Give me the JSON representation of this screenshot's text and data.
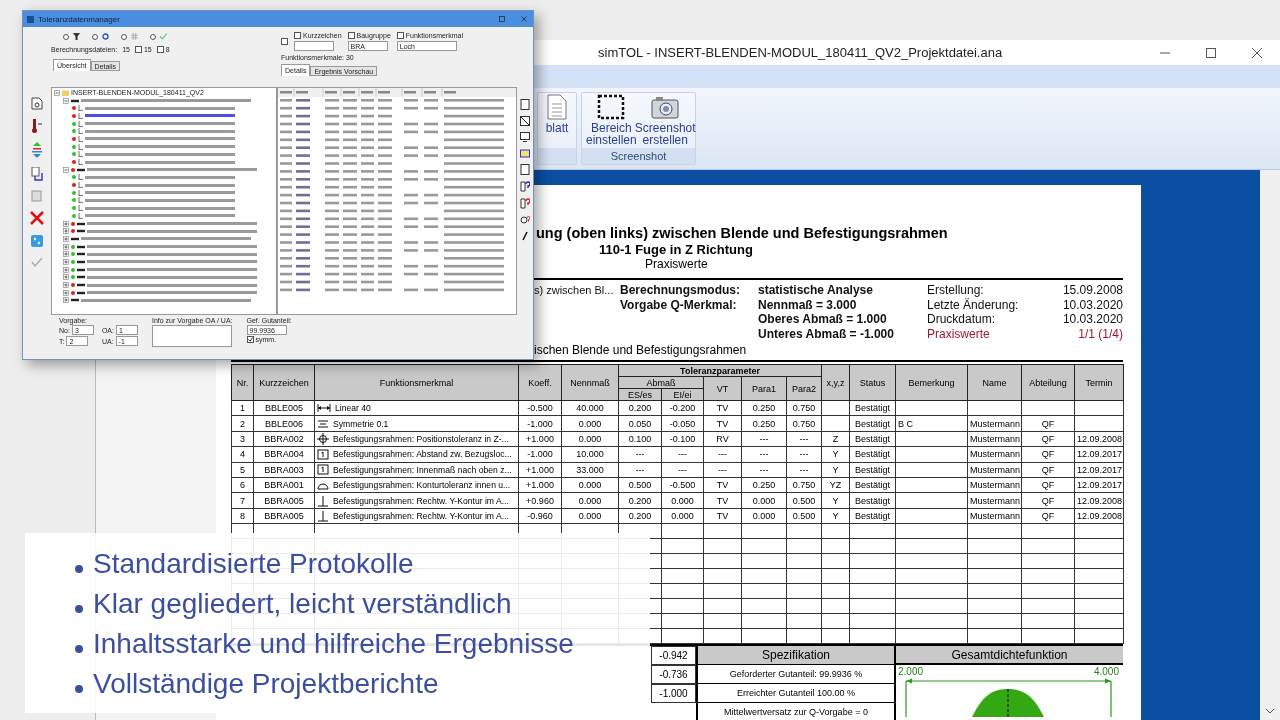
{
  "main_window": {
    "title": "simTOL - INSERT-BLENDEN-MODUL_180411_QV2_Projektdatei.ana",
    "ribbon_groups": [
      {
        "buttons": [
          {
            "label": "blatt",
            "kind": "document"
          }
        ]
      },
      {
        "label": "Screenshot",
        "buttons": [
          {
            "label": "Bereich einstellen",
            "kind": "region"
          },
          {
            "label": "Screenshot erstellen",
            "kind": "camera"
          }
        ]
      }
    ]
  },
  "report": {
    "title": "ung (oben links) zwischen Blende und Befestigungsrahmen",
    "subtitle": "110-1 Fuge in Z Richtung",
    "variant": "Praxiswerte",
    "info_partial": "s) zwischen Bl...",
    "info_rows": [
      {
        "label": "Berechnungsmodus:",
        "value": "statistische Analyse",
        "meta_label": "Erstellung:",
        "meta_value": "15.09.2008",
        "highlight": false
      },
      {
        "label": "Vorgabe Q-Merkmal:",
        "value": "Nennmaß = 3.000",
        "meta_label": "Letzte Änderung:",
        "meta_value": "10.03.2020",
        "highlight": false
      },
      {
        "value": "Oberes Abmaß = 1.000",
        "meta_label": "Druckdatum:",
        "meta_value": "10.03.2020",
        "highlight": false
      },
      {
        "value": "Unteres Abmaß = -1.000",
        "meta_label": "Praxiswerte",
        "meta_value": "1/1 (1/4)",
        "highlight": true
      }
    ],
    "description": "ischen Blende und Befestigungsrahmen",
    "columns": [
      "Nr.",
      "Kurzzeichen",
      "Funktionsmerkmal",
      "Koeff.",
      "Nennmaß",
      "x,y,z",
      "Status",
      "Bemerkung",
      "Name",
      "Abteilung",
      "Termin"
    ],
    "group_header": "Toleranzparameter",
    "abmass_header": "Abmaß",
    "sub_columns": [
      "ES/es",
      "EI/ei",
      "VT",
      "Para1",
      "Para2"
    ],
    "rows": [
      {
        "nr": "1",
        "code": "BBLE005",
        "kind": "linear",
        "feature": "Linear 40",
        "koeff": "-0.500",
        "nenn": "40.000",
        "es": "0.200",
        "ei": "-0.200",
        "vt": "TV",
        "p1": "0.250",
        "p2": "0.750",
        "status": "Bestätigt"
      },
      {
        "nr": "2",
        "code": "BBLE006",
        "kind": "symmetry",
        "feature": "Symmetrie 0.1",
        "koeff": "-1.000",
        "nenn": "0.000",
        "es": "0.050",
        "ei": "-0.050",
        "vt": "TV",
        "p1": "0.250",
        "p2": "0.750",
        "status": "Bestätigt",
        "note": "B C",
        "name": "Mustermann",
        "dept": "QF"
      },
      {
        "nr": "3",
        "code": "BBRA002",
        "kind": "position",
        "feature": "Befestigungsrahmen: Positionstoleranz in Z-...",
        "koeff": "+1.000",
        "nenn": "0.000",
        "es": "0.100",
        "ei": "-0.100",
        "vt": "RV",
        "p1": "---",
        "p2": "---",
        "xyz": "Z",
        "status": "Bestätigt",
        "name": "Mustermann",
        "dept": "QF",
        "date": "12.09.2008"
      },
      {
        "nr": "4",
        "code": "BBRA004",
        "kind": "boxed",
        "feature": "Befestigungsrahmen: Abstand zw. Bezugsloc...",
        "koeff": "-1.000",
        "nenn": "10.000",
        "es": "---",
        "ei": "---",
        "vt": "---",
        "p1": "---",
        "p2": "---",
        "xyz": "Y",
        "status": "Bestätigt",
        "name": "Mustermann",
        "dept": "QF",
        "date": "12.09.2017"
      },
      {
        "nr": "5",
        "code": "BBRA003",
        "kind": "boxed",
        "feature": "Befestigungsrahmen: Innenmaß nach oben z...",
        "koeff": "+1.000",
        "nenn": "33.000",
        "es": "---",
        "ei": "---",
        "vt": "---",
        "p1": "---",
        "p2": "---",
        "xyz": "Y",
        "status": "Bestätigt",
        "name": "Mustermann",
        "dept": "QF",
        "date": "12.09.2017"
      },
      {
        "nr": "6",
        "code": "BBRA001",
        "kind": "profile",
        "feature": "Befestigungsrahmen: Konturtoleranz innen u...",
        "koeff": "+1.000",
        "nenn": "0.000",
        "es": "0.500",
        "ei": "-0.500",
        "vt": "TV",
        "p1": "0.250",
        "p2": "0.750",
        "xyz": "YZ",
        "status": "Bestätigt",
        "name": "Mustermann",
        "dept": "QF",
        "date": "12.09.2017"
      },
      {
        "nr": "7",
        "code": "BBRA005",
        "kind": "perpendicular",
        "feature": "Befestigungsrahmen: Rechtw. Y-Kontur im A...",
        "koeff": "+0.960",
        "nenn": "0.000",
        "es": "0.200",
        "ei": "0.000",
        "vt": "TV",
        "p1": "0.000",
        "p2": "0.500",
        "xyz": "Y",
        "status": "Bestätigt",
        "name": "Mustermann",
        "dept": "QF",
        "date": "12.09.2008"
      },
      {
        "nr": "8",
        "code": "BBRA005",
        "kind": "perpendicular",
        "feature": "Befestigungsrahmen: Rechtw. Y-Kontur im A...",
        "koeff": "-0.960",
        "nenn": "0.000",
        "es": "0.200",
        "ei": "0.000",
        "vt": "TV",
        "p1": "0.000",
        "p2": "0.500",
        "xyz": "Y",
        "status": "Bestätigt",
        "name": "Mustermann",
        "dept": "QF",
        "date": "12.09.2008"
      }
    ],
    "summary_values": [
      "-0.942",
      "-0.736",
      "-1.000"
    ],
    "spec_title": "Spezifikation",
    "spec_rows": [
      "Geforderter Gutanteil: 99.9936 %",
      "Erreichter Gutanteil 100.00 %",
      "Mittelwertversatz zur Q-Vorgabe = 0"
    ],
    "density_title": "Gesamtdichtefunktion",
    "density_min": "2.000",
    "density_max": "4.000"
  },
  "tool_window": {
    "title": "Toleranzdatenmanager",
    "radios": [
      {
        "kind": "filter",
        "selected": false
      },
      {
        "kind": "refresh",
        "selected": false
      },
      {
        "kind": "grid",
        "selected": false
      },
      {
        "kind": "check",
        "selected": false
      }
    ],
    "calc_label": "Berechnungsdateien:",
    "calc_value": "15",
    "calc_options": [
      {
        "value": "15",
        "checked": false
      },
      {
        "value": "8",
        "checked": false
      }
    ],
    "all_checkbox": {
      "checked": false
    },
    "filters": [
      {
        "label": "Kurzzeichen",
        "checked": false
      },
      {
        "label": "Baugruppe",
        "checked": false,
        "value": "BRA"
      },
      {
        "label": "Funktionsmerkmal",
        "checked": false,
        "value": "Loch"
      }
    ],
    "count": "Funktionsmerkmale: 30",
    "left_tabs": [
      {
        "label": "Übersicht",
        "selected": true
      },
      {
        "label": "Details",
        "selected": false
      }
    ],
    "right_tabs": [
      {
        "label": "Details",
        "selected": true
      },
      {
        "label": "Ergebnis Vorschau",
        "selected": false
      }
    ],
    "tree": {
      "label": "INSERT-BLENDEN-MODUL_180411_QV2",
      "expanded": true,
      "children": [
        {
          "expanded": true,
          "children": [
            {
              "color": "#e02020",
              "selected": false
            },
            {
              "color": "#e02020",
              "selected": true
            },
            {
              "color": "#2fc22f",
              "selected": false
            },
            {
              "color": "#2fc22f",
              "selected": false
            },
            {
              "color": "#e02020",
              "selected": false
            },
            {
              "color": "#2fc22f",
              "selected": false
            },
            {
              "color": "#2fc22f",
              "selected": false
            },
            {
              "color": "#e02020",
              "selected": false
            }
          ]
        },
        {
          "color": "#e02020",
          "expanded": true,
          "children": [
            {
              "color": "#2fc22f",
              "selected": false
            },
            {
              "color": "#e02020",
              "selected": false
            },
            {
              "color": "#2fc22f",
              "selected": false
            },
            {
              "color": "#2fc22f",
              "selected": false
            },
            {
              "color": "#2fc22f",
              "selected": false
            },
            {
              "color": "#2fc22f",
              "selected": false
            }
          ]
        },
        {
          "color": "#e02020",
          "expanded": false
        },
        {
          "color": "#e02020",
          "expanded": false
        },
        {
          "expanded": false
        },
        {
          "color": "#2fc22f",
          "expanded": false
        },
        {
          "color": "#2fc22f",
          "expanded": false
        },
        {
          "color": "#2fc22f",
          "expanded": false
        },
        {
          "color": "#2fc22f",
          "expanded": false
        },
        {
          "color": "#2fc22f",
          "expanded": false
        },
        {
          "color": "#e02020",
          "expanded": false
        },
        {
          "color": "#e02020",
          "expanded": false
        },
        {
          "expanded": false
        }
      ]
    },
    "vorgabe_label": "Vorgabe:",
    "fields": [
      {
        "label": "No:",
        "value": "3"
      },
      {
        "label": "OA:",
        "value": "1"
      },
      {
        "label": "T:",
        "value": "2"
      },
      {
        "label": "UA:",
        "value": "-1"
      }
    ],
    "info_label": "Info zur Vorgabe OA / UA:",
    "gut_label": "Gef. Gutanteil:",
    "gut_value": "99.9936",
    "symm": {
      "label": "symm.",
      "checked": true
    }
  },
  "bullets": [
    "Standardisierte Protokolle",
    "Klar gegliedert, leicht verständlich",
    "Inhaltsstarke und hilfreiche Ergebnisse",
    "Vollständige Projektberichte"
  ]
}
